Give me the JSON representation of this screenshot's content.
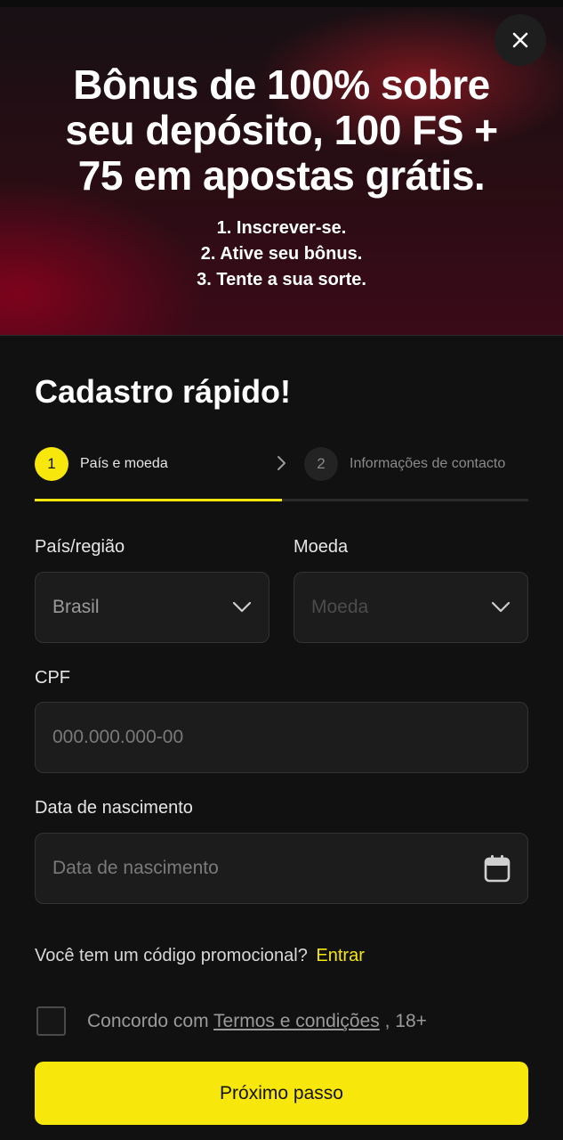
{
  "banner": {
    "title_lines": [
      "Bônus de 100% sobre",
      "seu depósito, 100 FS +",
      "75 em apostas grátis."
    ],
    "steps": [
      "1. Inscrever-se.",
      "2. Ative seu bônus.",
      "3. Tente a sua sorte."
    ],
    "close_icon": "close-icon"
  },
  "form": {
    "title": "Cadastro rápido!",
    "stepper": {
      "steps": [
        {
          "number": "1",
          "label": "País e moeda",
          "active": true
        },
        {
          "number": "2",
          "label": "Informações de contacto",
          "active": false
        }
      ],
      "progress": 0.5
    },
    "country": {
      "label": "País/região",
      "value": "Brasil"
    },
    "currency": {
      "label": "Moeda",
      "placeholder": "Moeda"
    },
    "cpf": {
      "label": "CPF",
      "placeholder": "000.000.000-00"
    },
    "birthdate": {
      "label": "Data de nascimento",
      "placeholder": "Data de nascimento",
      "icon": "calendar-icon"
    },
    "promo": {
      "question": "Você tem um código promocional?",
      "link": "Entrar"
    },
    "terms": {
      "prefix": "Concordo com ",
      "link": "Termos e condições",
      "suffix": " , 18+",
      "checked": false
    },
    "next_button": "Próximo passo"
  },
  "colors": {
    "accent": "#f7e70b",
    "background": "#111111",
    "field_background": "#1c1c1c"
  }
}
